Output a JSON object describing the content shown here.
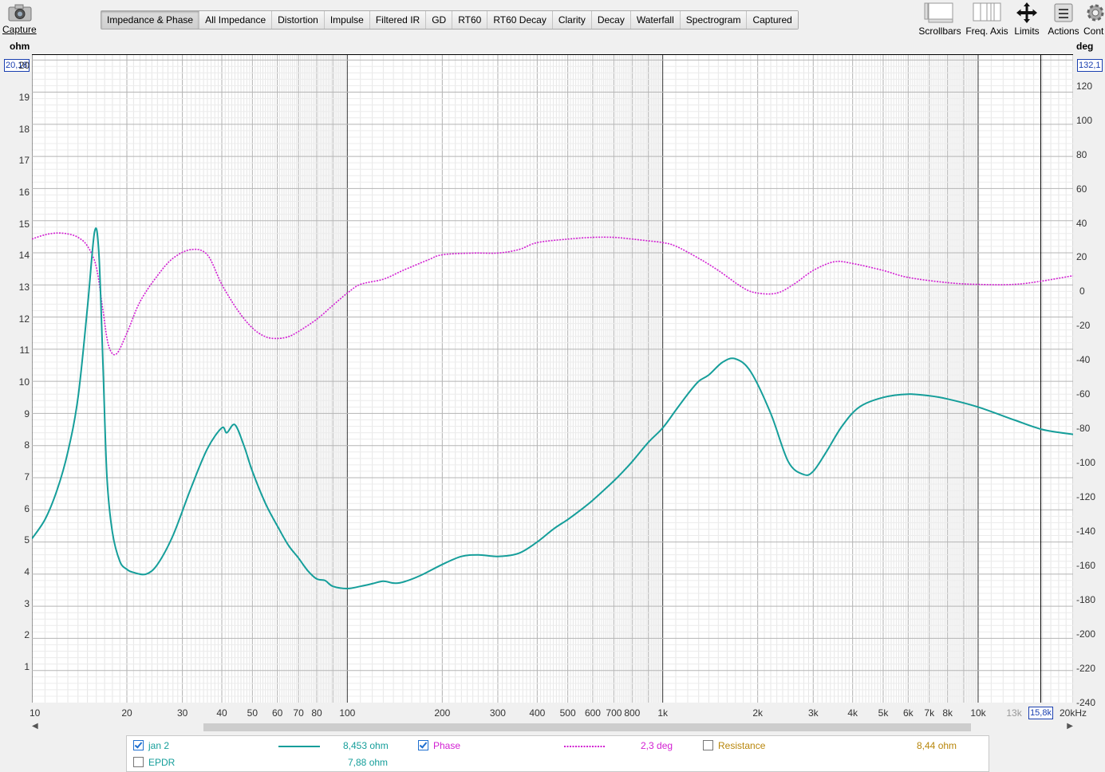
{
  "toolbar": {
    "capture_label": "Capture",
    "tabs": [
      "Impedance & Phase",
      "All Impedance",
      "Distortion",
      "Impulse",
      "Filtered IR",
      "GD",
      "RT60",
      "RT60 Decay",
      "Clarity",
      "Decay",
      "Waterfall",
      "Spectrogram",
      "Captured"
    ],
    "active_tab": "Impedance & Phase",
    "tools": {
      "scrollbars": "Scrollbars",
      "freq_axis": "Freq. Axis",
      "limits": "Limits",
      "actions": "Actions",
      "controls": "Cont"
    }
  },
  "axes": {
    "left_unit": "ohm",
    "right_unit": "deg",
    "left_cursor": "20,18",
    "right_cursor": "132,1",
    "x_cursor": "15,8k",
    "y_ticks": [
      "20",
      "19",
      "18",
      "17",
      "16",
      "15",
      "14",
      "13",
      "12",
      "11",
      "10",
      "9",
      "8",
      "7",
      "6",
      "5",
      "4",
      "3",
      "2",
      "1"
    ],
    "phase_ticks": [
      "120",
      "100",
      "80",
      "60",
      "40",
      "20",
      "0",
      "-20",
      "-40",
      "-60",
      "-80",
      "-100",
      "-120",
      "-140",
      "-160",
      "-180",
      "-200",
      "-220",
      "-240"
    ],
    "x_ticks": [
      "10",
      "20",
      "30",
      "40",
      "50",
      "60",
      "70",
      "80",
      "100",
      "200",
      "300",
      "400",
      "500",
      "600",
      "700",
      "800",
      "1k",
      "2k",
      "3k",
      "4k",
      "5k",
      "6k",
      "7k",
      "8k",
      "10k",
      "13k",
      "15,8k",
      "20kHz"
    ]
  },
  "legend": {
    "row1": {
      "name": "jan 2",
      "value": "8,453 ohm",
      "phase_name": "Phase",
      "phase_value": "2,3 deg",
      "res_name": "Resistance",
      "res_value": "8,44 ohm"
    },
    "row2": {
      "name": "EPDR",
      "value": "7,88 ohm"
    }
  },
  "colors": {
    "impedance": "#159e9a",
    "phase": "#d21fd2",
    "resistance": "#b8860b",
    "cursor": "#1a3fb0"
  },
  "chart_data": {
    "type": "line",
    "x_scale": "log",
    "xlim": [
      10,
      20000
    ],
    "ylim": [
      0,
      20.18
    ],
    "y2lim": [
      -240,
      132.1
    ],
    "grid": true,
    "series": [
      {
        "name": "jan 2",
        "axis": "left",
        "unit": "ohm",
        "x": [
          10,
          11,
          12,
          13,
          14,
          15,
          15.8,
          16.3,
          16.8,
          17.3,
          18,
          19,
          20,
          21,
          23,
          25,
          28,
          32,
          36,
          40,
          41.5,
          44,
          47,
          50,
          55,
          60,
          65,
          70,
          75,
          80,
          85,
          90,
          100,
          110,
          120,
          130,
          140,
          150,
          170,
          200,
          230,
          260,
          300,
          350,
          400,
          450,
          500,
          550,
          600,
          700,
          750,
          800,
          900,
          1000,
          1100,
          1200,
          1300,
          1400,
          1550,
          1700,
          1900,
          2200,
          2500,
          2800,
          3000,
          3300,
          3700,
          4200,
          5000,
          6000,
          7000,
          8000,
          10000,
          13000,
          16000,
          20000
        ],
        "y": [
          5.1,
          5.7,
          6.6,
          7.8,
          9.5,
          12.3,
          14.65,
          14.0,
          10.5,
          7.0,
          5.3,
          4.4,
          4.15,
          4.05,
          4.0,
          4.3,
          5.2,
          6.7,
          7.9,
          8.55,
          8.4,
          8.65,
          8.0,
          7.2,
          6.2,
          5.5,
          4.9,
          4.5,
          4.1,
          3.85,
          3.8,
          3.62,
          3.55,
          3.62,
          3.7,
          3.78,
          3.72,
          3.75,
          3.95,
          4.3,
          4.55,
          4.6,
          4.55,
          4.65,
          5.0,
          5.4,
          5.7,
          6.0,
          6.3,
          6.9,
          7.2,
          7.5,
          8.1,
          8.55,
          9.1,
          9.6,
          10.0,
          10.2,
          10.6,
          10.7,
          10.3,
          9.0,
          7.5,
          7.1,
          7.2,
          7.8,
          8.6,
          9.2,
          9.5,
          9.6,
          9.55,
          9.45,
          9.2,
          8.8,
          8.5,
          8.35
        ]
      },
      {
        "name": "Phase",
        "axis": "right",
        "unit": "deg",
        "x": [
          10,
          11,
          12,
          13,
          14,
          15,
          16,
          16.8,
          17.5,
          18.5,
          20,
          22,
          25,
          28,
          32,
          36,
          40,
          45,
          50,
          55,
          60,
          65,
          70,
          80,
          90,
          100,
          110,
          130,
          150,
          180,
          200,
          250,
          300,
          350,
          400,
          500,
          600,
          700,
          800,
          900,
          1000,
          1100,
          1300,
          1500,
          1800,
          2000,
          2300,
          2600,
          3000,
          3500,
          4000,
          5000,
          6000,
          8000,
          10000,
          13000,
          16000,
          20000
        ],
        "y": [
          26,
          28.5,
          29.5,
          29,
          27,
          22,
          10,
          -15,
          -35,
          -40,
          -28,
          -10,
          5,
          15,
          20,
          17,
          0,
          -15,
          -25,
          -30,
          -31,
          -30,
          -27,
          -20,
          -12,
          -5,
          0,
          3,
          8,
          14,
          17,
          18,
          18,
          20,
          24,
          26,
          27,
          27,
          26,
          25,
          24,
          22,
          15,
          8,
          -2,
          -5,
          -5,
          0,
          8,
          13,
          12,
          8,
          4,
          1,
          0,
          0,
          2,
          5
        ]
      },
      {
        "name": "Resistance",
        "axis": "left",
        "unit": "ohm",
        "visible": false,
        "x": [],
        "y": []
      },
      {
        "name": "EPDR",
        "axis": "left",
        "unit": "ohm",
        "visible": false,
        "x": [],
        "y": []
      }
    ]
  }
}
